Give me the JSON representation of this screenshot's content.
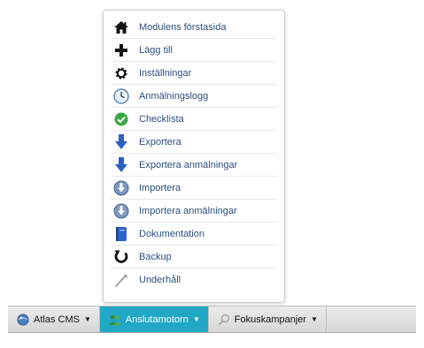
{
  "dropdown": {
    "items": [
      {
        "label": "Modulens förstasida",
        "icon": "home-icon"
      },
      {
        "label": "Lägg till",
        "icon": "plus-icon"
      },
      {
        "label": "Inställningar",
        "icon": "gear-icon"
      },
      {
        "label": "Anmälningslogg",
        "icon": "clock-icon"
      },
      {
        "label": "Checklista",
        "icon": "check-circle-icon"
      },
      {
        "label": "Exportera",
        "icon": "arrow-down-icon"
      },
      {
        "label": "Exportera anmälningar",
        "icon": "arrow-down-icon"
      },
      {
        "label": "Importera",
        "icon": "import-globe-icon"
      },
      {
        "label": "Importera anmälningar",
        "icon": "import-globe-icon"
      },
      {
        "label": "Dokumentation",
        "icon": "book-icon"
      },
      {
        "label": "Backup",
        "icon": "refresh-icon"
      },
      {
        "label": "Underhåll",
        "icon": "wrench-icon"
      }
    ]
  },
  "menubar": {
    "items": [
      {
        "label": "Atlas CMS",
        "icon": "globe-icon",
        "caret": "▼"
      },
      {
        "label": "Anslutamotorn",
        "icon": "people-icon",
        "caret": "▼"
      },
      {
        "label": "Fokuskampanjer",
        "icon": "magnifier-icon",
        "caret": "▼"
      }
    ]
  },
  "colors": {
    "active_tab": "#21a8c6",
    "menu_text": "#2d4f7d"
  }
}
